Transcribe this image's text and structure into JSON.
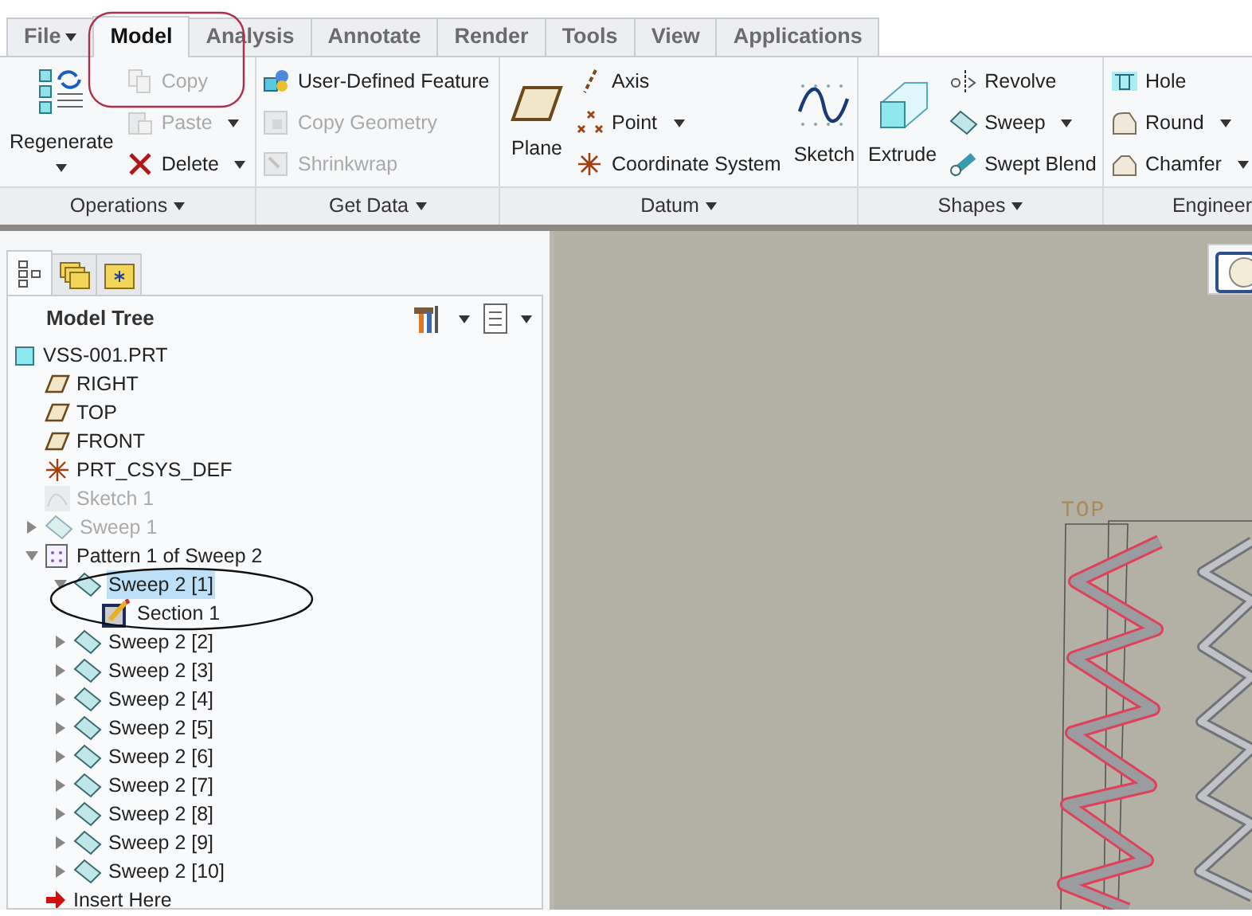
{
  "tabs": [
    {
      "label": "File",
      "selected": false,
      "has_menu": true
    },
    {
      "label": "Model",
      "selected": true,
      "has_menu": false
    },
    {
      "label": "Analysis",
      "selected": false,
      "has_menu": false
    },
    {
      "label": "Annotate",
      "selected": false,
      "has_menu": false
    },
    {
      "label": "Render",
      "selected": false,
      "has_menu": false
    },
    {
      "label": "Tools",
      "selected": false,
      "has_menu": false
    },
    {
      "label": "View",
      "selected": false,
      "has_menu": false
    },
    {
      "label": "Applications",
      "selected": false,
      "has_menu": false
    }
  ],
  "ribbon_groups": [
    {
      "label": "Operations",
      "has_menu": true,
      "commands": [
        {
          "label": "Regenerate",
          "kind": "large",
          "disabled": false,
          "dropdown": true
        },
        {
          "label": "Copy",
          "kind": "small",
          "disabled": true,
          "dropdown": false
        },
        {
          "label": "Paste",
          "kind": "small",
          "disabled": true,
          "dropdown": true
        },
        {
          "label": "Delete",
          "kind": "small",
          "disabled": false,
          "dropdown": true
        }
      ]
    },
    {
      "label": "Get Data",
      "has_menu": true,
      "commands": [
        {
          "label": "User-Defined Feature",
          "kind": "small",
          "disabled": false,
          "dropdown": false
        },
        {
          "label": "Copy Geometry",
          "kind": "small",
          "disabled": true,
          "dropdown": false
        },
        {
          "label": "Shrinkwrap",
          "kind": "small",
          "disabled": true,
          "dropdown": false
        }
      ]
    },
    {
      "label": "Datum",
      "has_menu": true,
      "commands": [
        {
          "label": "Plane",
          "kind": "large",
          "disabled": false,
          "dropdown": false
        },
        {
          "label": "Axis",
          "kind": "small",
          "disabled": false,
          "dropdown": false
        },
        {
          "label": "Point",
          "kind": "small",
          "disabled": false,
          "dropdown": true
        },
        {
          "label": "Coordinate System",
          "kind": "small",
          "disabled": false,
          "dropdown": false
        },
        {
          "label": "Sketch",
          "kind": "large",
          "disabled": false,
          "dropdown": false
        }
      ]
    },
    {
      "label": "Shapes",
      "has_menu": true,
      "commands": [
        {
          "label": "Extrude",
          "kind": "large",
          "disabled": false,
          "dropdown": false
        },
        {
          "label": "Revolve",
          "kind": "small",
          "disabled": false,
          "dropdown": false
        },
        {
          "label": "Sweep",
          "kind": "small",
          "disabled": false,
          "dropdown": true
        },
        {
          "label": "Swept Blend",
          "kind": "small",
          "disabled": false,
          "dropdown": false
        }
      ]
    },
    {
      "label": "Engineer",
      "commands": [
        {
          "label": "Hole",
          "kind": "small",
          "disabled": false,
          "dropdown": false
        },
        {
          "label": "Round",
          "kind": "small",
          "disabled": false,
          "dropdown": true
        },
        {
          "label": "Chamfer",
          "kind": "small",
          "disabled": false,
          "dropdown": true
        }
      ]
    }
  ],
  "navigator_tabs": [
    {
      "selected": true
    },
    {
      "selected": false
    },
    {
      "selected": false
    }
  ],
  "model_tree": {
    "title": "Model Tree",
    "items": [
      {
        "label": "VSS-001.PRT",
        "kind": "part",
        "disabled": false,
        "selected": false,
        "children": [
          {
            "label": "RIGHT",
            "kind": "plane",
            "disabled": false,
            "selected": false
          },
          {
            "label": "TOP",
            "kind": "plane",
            "disabled": false,
            "selected": false
          },
          {
            "label": "FRONT",
            "kind": "plane",
            "disabled": false,
            "selected": false
          },
          {
            "label": "PRT_CSYS_DEF",
            "kind": "csys",
            "disabled": false,
            "selected": false
          },
          {
            "label": "Sketch 1",
            "kind": "sketch",
            "disabled": true,
            "selected": false
          },
          {
            "label": "Sweep 1",
            "kind": "sweep",
            "disabled": true,
            "selected": false,
            "expanded": false
          },
          {
            "label": "Pattern 1 of Sweep 2",
            "kind": "pattern",
            "disabled": false,
            "selected": false,
            "expanded": true,
            "children": [
              {
                "label": "Sweep 2 [1]",
                "kind": "sweep",
                "disabled": false,
                "selected": true,
                "expanded": true,
                "children": [
                  {
                    "label": "Section 1",
                    "kind": "section",
                    "disabled": false,
                    "selected": false
                  }
                ]
              },
              {
                "label": "Sweep 2 [2]",
                "kind": "sweep",
                "disabled": false,
                "selected": false,
                "expanded": false
              },
              {
                "label": "Sweep 2 [3]",
                "kind": "sweep",
                "disabled": false,
                "selected": false,
                "expanded": false
              },
              {
                "label": "Sweep 2 [4]",
                "kind": "sweep",
                "disabled": false,
                "selected": false,
                "expanded": false
              },
              {
                "label": "Sweep 2 [5]",
                "kind": "sweep",
                "disabled": false,
                "selected": false,
                "expanded": false
              },
              {
                "label": "Sweep 2 [6]",
                "kind": "sweep",
                "disabled": false,
                "selected": false,
                "expanded": false
              },
              {
                "label": "Sweep 2 [7]",
                "kind": "sweep",
                "disabled": false,
                "selected": false,
                "expanded": false
              },
              {
                "label": "Sweep 2 [8]",
                "kind": "sweep",
                "disabled": false,
                "selected": false,
                "expanded": false
              },
              {
                "label": "Sweep 2 [9]",
                "kind": "sweep",
                "disabled": false,
                "selected": false,
                "expanded": false
              },
              {
                "label": "Sweep 2 [10]",
                "kind": "sweep",
                "disabled": false,
                "selected": false,
                "expanded": false
              }
            ]
          },
          {
            "label": "Insert Here",
            "kind": "insert",
            "disabled": false,
            "selected": false
          }
        ]
      }
    ]
  },
  "viewport": {
    "datum_label": "TOP"
  }
}
